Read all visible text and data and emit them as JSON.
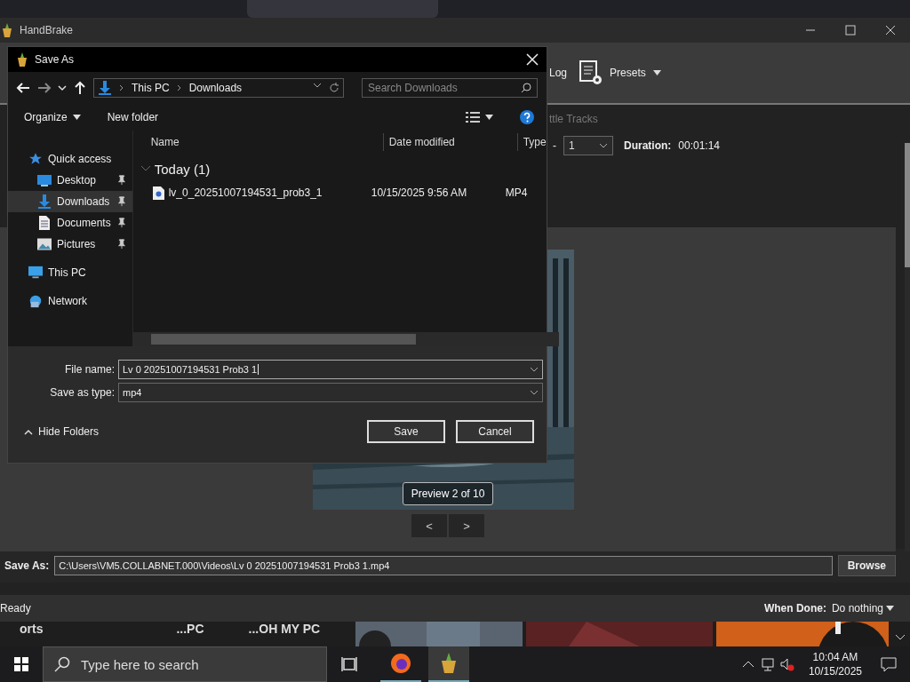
{
  "handbrake": {
    "title": "HandBrake",
    "toolbar": [
      {
        "label": "Log",
        "kind": "log"
      },
      {
        "label": "Presets",
        "kind": "presets"
      }
    ],
    "tab": "ttle Tracks",
    "range": {
      "separator": "-",
      "value": "1"
    },
    "duration": {
      "label": "Duration:",
      "value": "00:01:14"
    },
    "preview": {
      "badge": "Preview 2 of 10",
      "prev": "<",
      "next": ">"
    },
    "save_as": {
      "label": "Save As:",
      "value": "C:\\Users\\VM5.COLLABNET.000\\Videos\\Lv 0 20251007194531 Prob3 1.mp4",
      "button": "Browse"
    },
    "status": "Ready",
    "when_done": {
      "label": "When Done:",
      "value": "Do nothing"
    }
  },
  "dialog": {
    "title": "Save As",
    "breadcrumb": [
      "This PC",
      "Downloads"
    ],
    "search": {
      "placeholder": "Search Downloads"
    },
    "commands": [
      {
        "label": "Organize",
        "kind": "menu"
      },
      {
        "label": "New folder",
        "kind": "plain"
      }
    ],
    "nav": [
      {
        "label": "Quick access",
        "kind": "star",
        "selected": false,
        "pinned": false,
        "children": [
          {
            "label": "Desktop",
            "kind": "desktop",
            "selected": false,
            "pinned": true
          },
          {
            "label": "Downloads",
            "kind": "download",
            "selected": true,
            "pinned": true
          },
          {
            "label": "Documents",
            "kind": "document",
            "selected": false,
            "pinned": true
          },
          {
            "label": "Pictures",
            "kind": "pictures",
            "selected": false,
            "pinned": true
          }
        ]
      },
      {
        "label": "This PC",
        "kind": "pc",
        "selected": false,
        "pinned": false
      },
      {
        "label": "Network",
        "kind": "network",
        "selected": false,
        "pinned": false
      }
    ],
    "columns": [
      "Name",
      "Date modified",
      "Type"
    ],
    "group": {
      "label": "Today (1)",
      "expanded": true
    },
    "files": [
      {
        "name": "lv_0_20251007194531_prob3_1",
        "date": "10/15/2025 9:56 AM",
        "type": "MP4"
      }
    ],
    "file_name": {
      "label": "File name:",
      "value": "Lv 0 20251007194531 Prob3 1"
    },
    "save_type": {
      "label": "Save as type:",
      "value": "mp4"
    },
    "hide_folders": "Hide Folders",
    "buttons": [
      "Save",
      "Cancel"
    ]
  },
  "browser_tiles": [
    {
      "title": "orts"
    },
    {
      "title": "...PC"
    },
    {
      "title": "...OH MY PC"
    }
  ],
  "taskbar": {
    "search": {
      "placeholder": "Type here to search"
    },
    "apps": [
      {
        "kind": "firefox",
        "selected": false
      },
      {
        "kind": "handbrake",
        "selected": true
      }
    ],
    "time": "10:04 AM",
    "date": "10/15/2025"
  }
}
